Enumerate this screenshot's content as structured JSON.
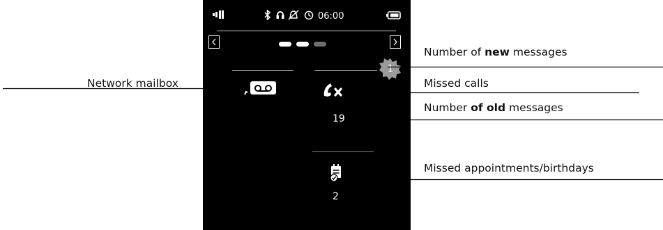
{
  "screen": {
    "clock": "06:00",
    "new_messages_badge": "1",
    "missed_calls_count": "19",
    "missed_appointments_count": "2",
    "page_indicator": {
      "total": 3,
      "active": [
        0,
        1
      ]
    },
    "icons": {
      "signal": "signal-strength-icon",
      "bluetooth": "bluetooth-icon",
      "headset": "headset-icon",
      "ringer_off": "ringer-off-icon",
      "alarm": "alarm-clock-icon",
      "battery": "battery-icon",
      "nav_left": "chevron-left-icon",
      "nav_right": "chevron-right-icon",
      "mailbox": "network-mailbox-icon",
      "missed_call": "missed-call-icon",
      "appointment": "appointment-icon"
    },
    "colors": {
      "background": "#000000",
      "foreground": "#ffffff",
      "badge": "#9a9a9a",
      "inactive_dot": "#6e6e6e"
    }
  },
  "callouts": {
    "network_mailbox": "Network mailbox",
    "new_messages": {
      "before": "Number of ",
      "bold": "new",
      "after": " messages"
    },
    "missed_calls": "Missed calls",
    "old_messages": {
      "before": "Number ",
      "bold": "of old",
      "after": " messages"
    },
    "missed_appointments": "Missed appointments/birthdays"
  }
}
